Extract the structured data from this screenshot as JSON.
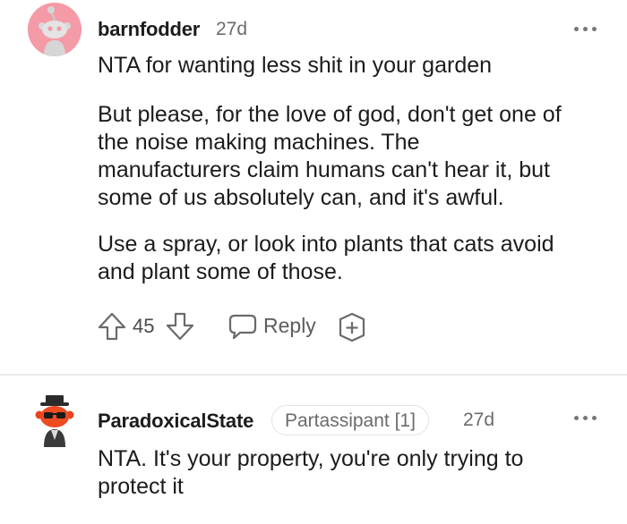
{
  "comments": [
    {
      "username": "barnfodder",
      "age": "27d",
      "paragraphs": [
        "NTA for wanting less shit in your garden",
        "But please, for the love of god, don't get one of\nthe noise making machines. The\nmanufacturers claim humans can't hear it, but\nsome of us absolutely can, and it's awful.",
        "Use a spray, or look into plants that cats avoid\nand plant some of those."
      ],
      "votes": "45",
      "reply_label": "Reply",
      "avatar_color": "#f59ba8"
    },
    {
      "username": "ParadoxicalState",
      "flair": "Partassipant [1]",
      "age": "27d",
      "paragraphs": [
        "NTA. It's your property, you're only trying to\nprotect it"
      ]
    }
  ],
  "icons": {
    "upvote": "arrow-up-outline-icon",
    "downvote": "arrow-down-outline-icon",
    "reply": "speech-bubble-icon",
    "award": "add-award-icon",
    "more": "more-options-dots-icon"
  }
}
